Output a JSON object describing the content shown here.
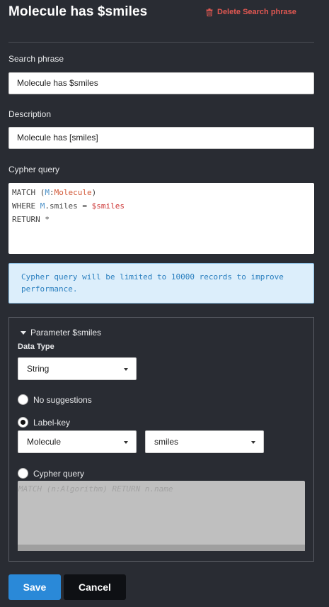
{
  "header": {
    "title": "Molecule has $smiles",
    "delete_label": "Delete Search phrase"
  },
  "search_phrase": {
    "label": "Search phrase",
    "value": "Molecule has $smiles"
  },
  "description": {
    "label": "Description",
    "value": "Molecule has [smiles]"
  },
  "cypher": {
    "label": "Cypher query",
    "line1_kw": "MATCH (",
    "line1_var": "M",
    "line1_sep": ":",
    "line1_label": "Molecule",
    "line1_end": ")",
    "line2_kw": "WHERE ",
    "line2_var": "M",
    "line2_mid": ".smiles = ",
    "line2_param": "$smiles",
    "line3": "RETURN *"
  },
  "info": {
    "text": "Cypher query will be limited to 10000 records to improve performance."
  },
  "parameter": {
    "header": "Parameter $smiles",
    "data_type_label": "Data Type",
    "data_type_value": "String",
    "options": {
      "no_suggestions": "No suggestions",
      "label_key": "Label-key",
      "cypher_query": "Cypher query"
    },
    "selected_option": "label_key",
    "label_value": "Molecule",
    "key_value": "smiles",
    "query_placeholder": "MATCH (n:Algorithm) RETURN n.name"
  },
  "actions": {
    "save": "Save",
    "cancel": "Cancel"
  },
  "colors": {
    "background": "#292c33",
    "delete": "#e25852",
    "info_bg": "#dceefb",
    "info_text": "#2a7fbf",
    "save_bg": "#2a89d8",
    "cancel_bg": "#0e1014"
  },
  "icons": {
    "delete": "trash-icon",
    "param_toggle": "caret-down-icon",
    "select_arrow": "caret-down-icon"
  }
}
